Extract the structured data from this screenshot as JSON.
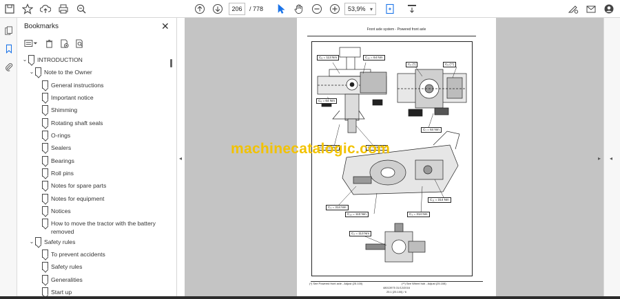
{
  "toolbar": {
    "current_page": "206",
    "total_pages": "/ 778",
    "zoom": "53,9%",
    "zoom_arrow": "▾"
  },
  "bookmarks_panel": {
    "title": "Bookmarks",
    "close": "✕",
    "items": [
      {
        "label": "INTRODUCTION",
        "level": 0,
        "expanded": true
      },
      {
        "label": "Note to the Owner",
        "level": 1,
        "expanded": true
      },
      {
        "label": "General instructions",
        "level": 2
      },
      {
        "label": "Important notice",
        "level": 2
      },
      {
        "label": "Shimming",
        "level": 2
      },
      {
        "label": "Rotating shaft seals",
        "level": 2
      },
      {
        "label": "O-rings",
        "level": 2
      },
      {
        "label": "Sealers",
        "level": 2
      },
      {
        "label": "Bearings",
        "level": 2
      },
      {
        "label": "Roll pins",
        "level": 2
      },
      {
        "label": "Notes for spare parts",
        "level": 2
      },
      {
        "label": "Notes for equipment",
        "level": 2
      },
      {
        "label": "Notices",
        "level": 2
      },
      {
        "label": "How to move the tractor with the battery removed",
        "level": 2
      },
      {
        "label": "Safety rules",
        "level": 1,
        "expanded": true
      },
      {
        "label": "To prevent accidents",
        "level": 2
      },
      {
        "label": "Safety rules",
        "level": 2
      },
      {
        "label": "Generalities",
        "level": 2
      },
      {
        "label": "Start up",
        "level": 2
      }
    ]
  },
  "document": {
    "header": "Front axle system - Powered front axle",
    "callouts": {
      "c8_top": "C₈ = 113 Nm",
      "c10_top": "C₁₀ = 64 Nm",
      "c5": "C₅ (*)",
      "c9": "C₉ (**)",
      "c6_64": "C₆ = 64 Nm",
      "c6_113": "C₆ = 113 Nm",
      "c7_294": "C₇ = 294 Nm",
      "c7_64": "C₇ = 64 Nm",
      "c4_314": "C₄ = 314 Nm",
      "c11_314": "C₁₁ = 314 Nm",
      "c10_113": "C₁₀ = 113 Nm",
      "c3_314": "C₃ = 314 Nm",
      "c2_113": "C₂ = 113 Nm"
    },
    "footnote_left": "(*) See Powered front axle - Adjust (25.100)",
    "footnote_right": "(**) See Wheel hub - Adjust (25.108)",
    "footer_line1": "48013975 31/12/2016",
    "footer_line2": "25.1 [25.100] / 6"
  },
  "watermark": "machinecatalogic.com",
  "colors": {
    "watermark": "#f2c200",
    "doc_background": "#c4c4c4"
  }
}
